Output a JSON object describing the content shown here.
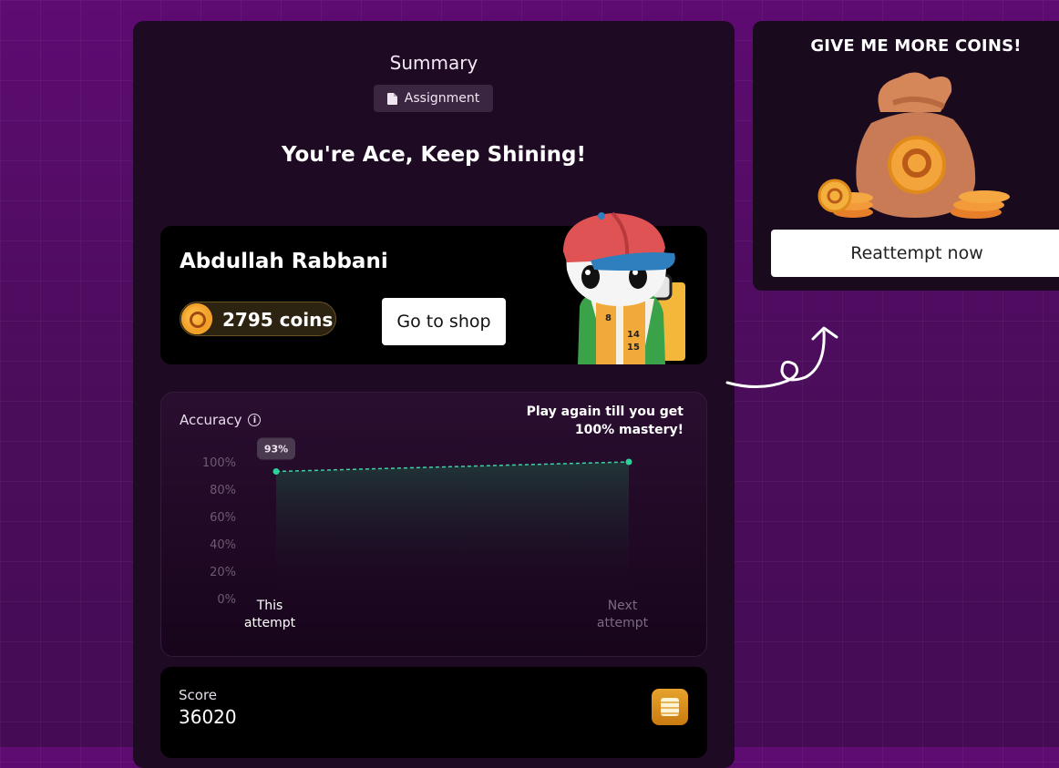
{
  "summary": {
    "title": "Summary",
    "badge_label": "Assignment",
    "headline": "You're Ace, Keep Shining!"
  },
  "user": {
    "name": "Abdullah Rabbani",
    "coins_text": "2795 coins",
    "shop_label": "Go to shop"
  },
  "accuracy": {
    "label": "Accuracy",
    "hint": "Play again till you get 100% mastery!"
  },
  "chart_data": {
    "type": "area",
    "categories": [
      "This attempt",
      "Next attempt"
    ],
    "series": [
      {
        "values": [
          93,
          100
        ]
      }
    ],
    "data_labels": [
      "93%"
    ],
    "yticks": [
      "100%",
      "80%",
      "60%",
      "40%",
      "20%",
      "0%"
    ],
    "ylim": [
      0,
      100
    ],
    "colors": {
      "line": "#3fd1a8",
      "point": "#2fd19a"
    },
    "grid": false
  },
  "score": {
    "label": "Score",
    "value": "36020"
  },
  "coins_panel": {
    "title": "GIVE ME MORE COINS!",
    "reattempt_label": "Reattempt now"
  },
  "colors": {
    "background": "#4e0d5e",
    "panel": "#1f0a23",
    "coin_gold": "#f2a22a"
  }
}
